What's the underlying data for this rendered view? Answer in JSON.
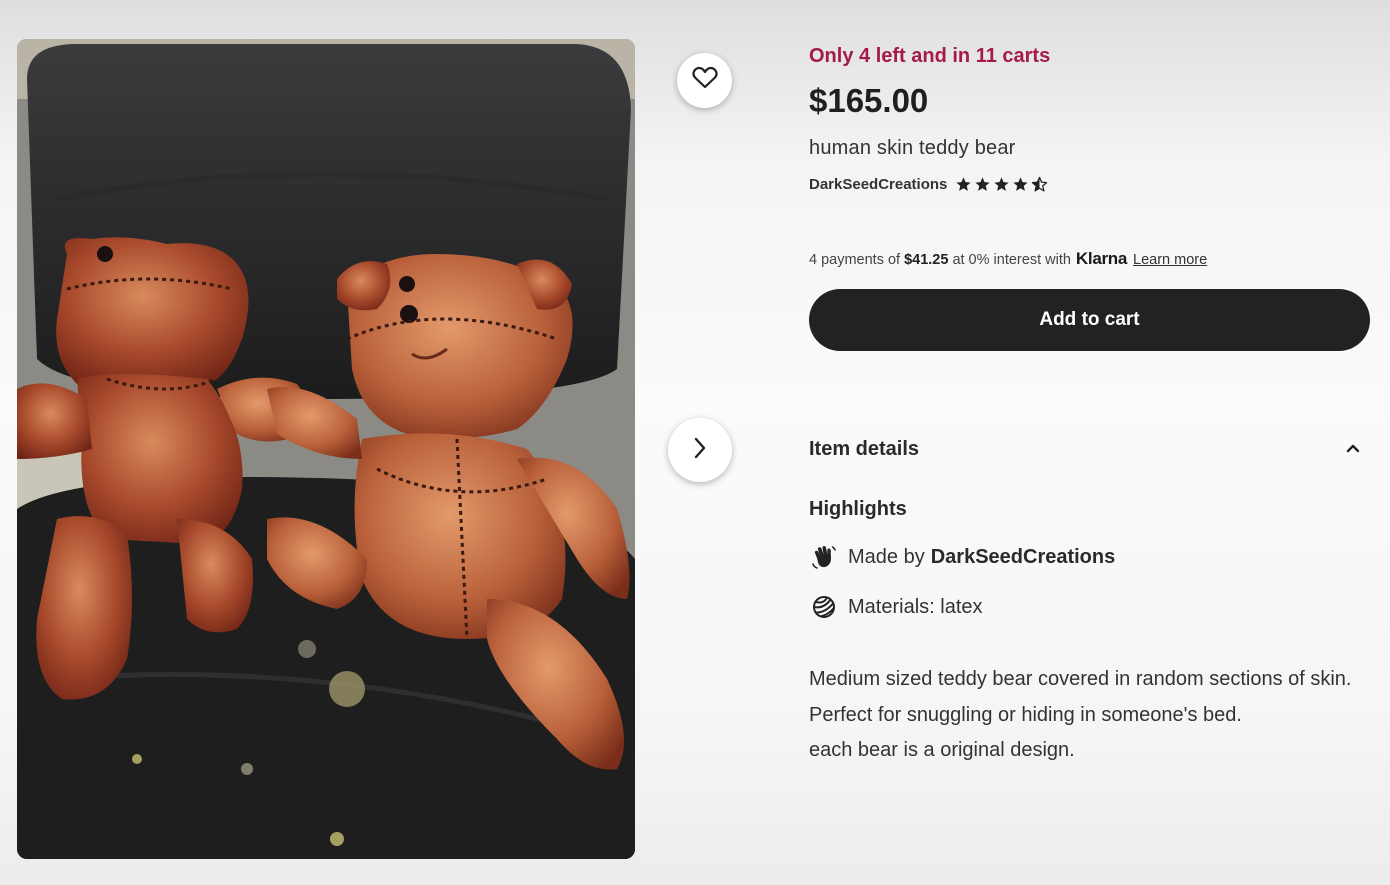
{
  "listing": {
    "stock_notice": "Only 4 left and in 11 carts",
    "price": "$165.00",
    "title": "human skin teddy bear",
    "shop_name": "DarkSeedCreations",
    "rating": 4.5,
    "rating_max": 5
  },
  "payments": {
    "prefix": "4 payments of",
    "amount": "$41.25",
    "suffix": "at 0% interest with",
    "provider": "Klarna",
    "learn_more": "Learn more"
  },
  "actions": {
    "add_to_cart": "Add to cart"
  },
  "item_details": {
    "heading": "Item details",
    "highlights_heading": "Highlights",
    "made_by_prefix": "Made by",
    "made_by_shop": "DarkSeedCreations",
    "materials": "Materials: latex",
    "description_lines": [
      "Medium sized teddy bear covered in random sections of skin. Perfect for snuggling or hiding in someone's bed.",
      "each bear is a original design."
    ]
  },
  "icons": {
    "favorite": "heart-icon",
    "next_image": "chevron-right-icon",
    "collapse": "chevron-up-icon",
    "made_by": "hand-wave-icon",
    "materials": "materials-ball-icon"
  },
  "colors": {
    "stock_notice": "#a61a4b",
    "cart_button": "#222222"
  }
}
